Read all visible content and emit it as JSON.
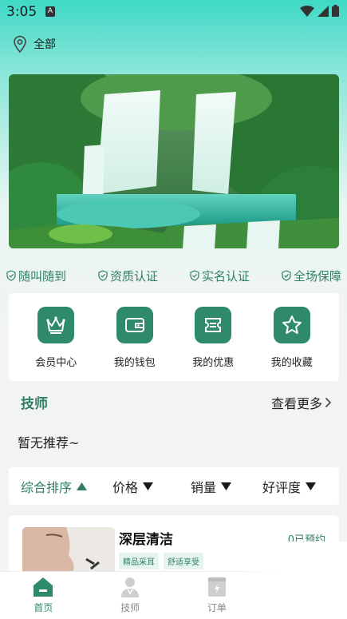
{
  "status_bar": {
    "time": "3:05",
    "badge": "A"
  },
  "location": {
    "label": "全部"
  },
  "guarantees": [
    "随叫随到",
    "资质认证",
    "实名认证",
    "全场保障"
  ],
  "quick_links": [
    {
      "label": "会员中心",
      "icon": "crown-icon"
    },
    {
      "label": "我的钱包",
      "icon": "wallet-icon"
    },
    {
      "label": "我的优惠",
      "icon": "coupon-icon"
    },
    {
      "label": "我的收藏",
      "icon": "star-icon"
    }
  ],
  "technicians": {
    "title": "技师",
    "more_label": "查看更多",
    "empty_text": "暂无推荐~"
  },
  "sort": {
    "items": [
      "综合排序",
      "价格",
      "销量",
      "好评度"
    ],
    "active_index": 0
  },
  "services": [
    {
      "title": "深层清洁",
      "count": "0已预约",
      "tags": [
        "精品采耳",
        "舒适享受"
      ]
    }
  ],
  "tabs": [
    {
      "label": "首页",
      "icon": "home-icon",
      "active": true
    },
    {
      "label": "技师",
      "icon": "technician-icon",
      "active": false
    },
    {
      "label": "订单",
      "icon": "order-icon",
      "active": false
    }
  ],
  "colors": {
    "accent": "#2f7f63",
    "icon_bg": "#2f8a69",
    "header_gradient_top": "#3fd9c6"
  }
}
